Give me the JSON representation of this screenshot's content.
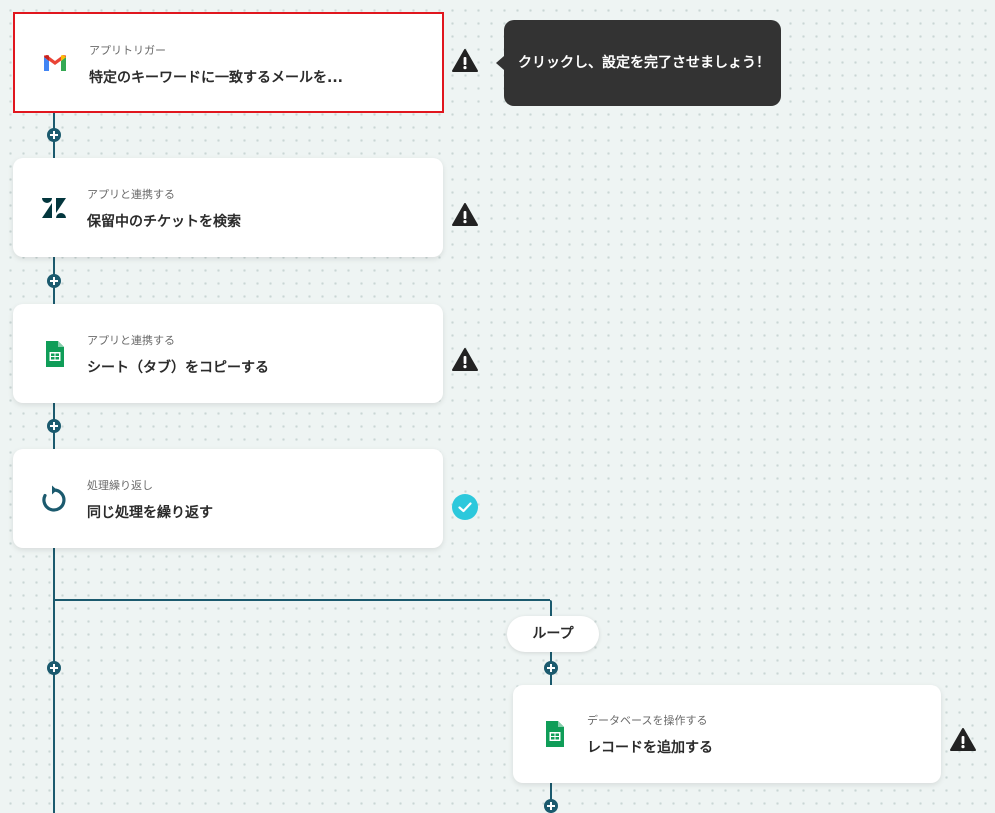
{
  "tooltip": {
    "text": "クリックし、設定を完了させましょう！"
  },
  "steps": [
    {
      "subtitle": "アプリトリガー",
      "title": "特定のキーワードに一致するメールを...",
      "icon": "gmail-icon",
      "status": "warning"
    },
    {
      "subtitle": "アプリと連携する",
      "title": "保留中のチケットを検索",
      "icon": "zendesk-icon",
      "status": "warning"
    },
    {
      "subtitle": "アプリと連携する",
      "title": "シート（タブ）をコピーする",
      "icon": "google-sheets-icon",
      "status": "warning"
    },
    {
      "subtitle": "処理繰り返し",
      "title": "同じ処理を繰り返す",
      "icon": "loop-icon",
      "status": "completed"
    },
    {
      "subtitle": "データベースを操作する",
      "title": "レコードを追加する",
      "icon": "google-sheets-icon",
      "status": "warning"
    }
  ],
  "loop": {
    "label": "ループ"
  },
  "colors": {
    "connector": "#1b5a6e",
    "selected_border": "#e0161e",
    "check": "#2cc8dc",
    "tooltip_bg": "#333333"
  }
}
